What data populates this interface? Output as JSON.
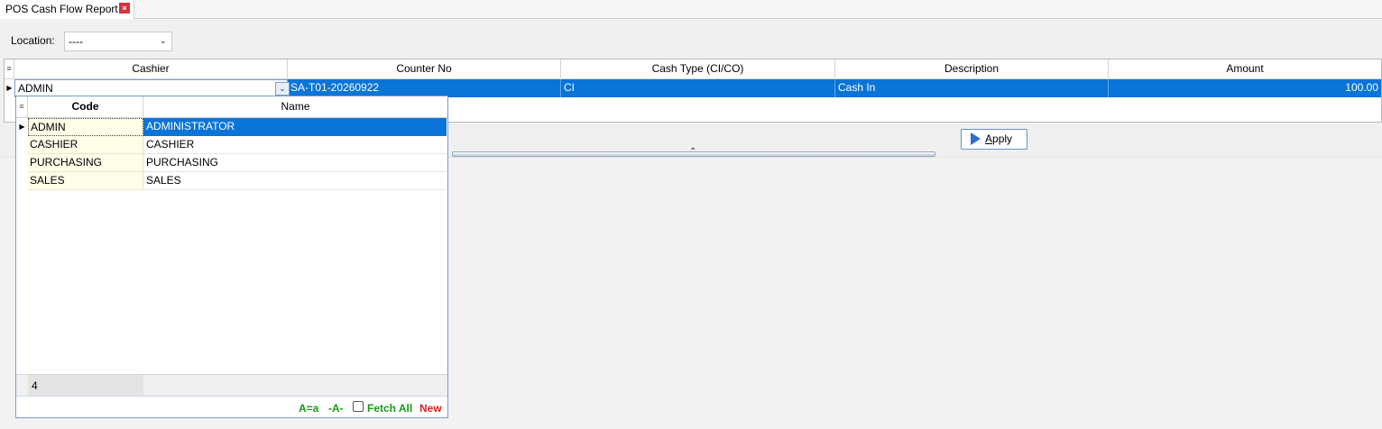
{
  "tab": {
    "title": "POS Cash Flow Report",
    "close_glyph": "×"
  },
  "location": {
    "label": "Location:",
    "value": "----"
  },
  "grid": {
    "headers": [
      "Cashier",
      "Counter No",
      "Cash Type (CI/CO)",
      "Description",
      "Amount"
    ],
    "row": {
      "cashier": "ADMIN",
      "counter_no": "SA-T01-20260922",
      "cash_type": "CI",
      "description": "Cash In",
      "amount": "100.00"
    }
  },
  "apply_button": {
    "label_first": "A",
    "label_rest": "pply"
  },
  "lookup": {
    "headers": {
      "code": "Code",
      "name": "Name"
    },
    "rows": [
      {
        "code": "ADMIN",
        "name": "ADMINISTRATOR"
      },
      {
        "code": "CASHIER",
        "name": "CASHIER"
      },
      {
        "code": "PURCHASING",
        "name": "PURCHASING"
      },
      {
        "code": "SALES",
        "name": "SALES"
      }
    ],
    "count": "4",
    "case_toggle": "A=a",
    "dash_toggle": "-A-",
    "fetch_all": "Fetch All",
    "fetch_all_checked": false,
    "new_label": "New"
  },
  "colors": {
    "selection": "#0a74d8",
    "green": "#169c16",
    "red": "#e02020"
  }
}
